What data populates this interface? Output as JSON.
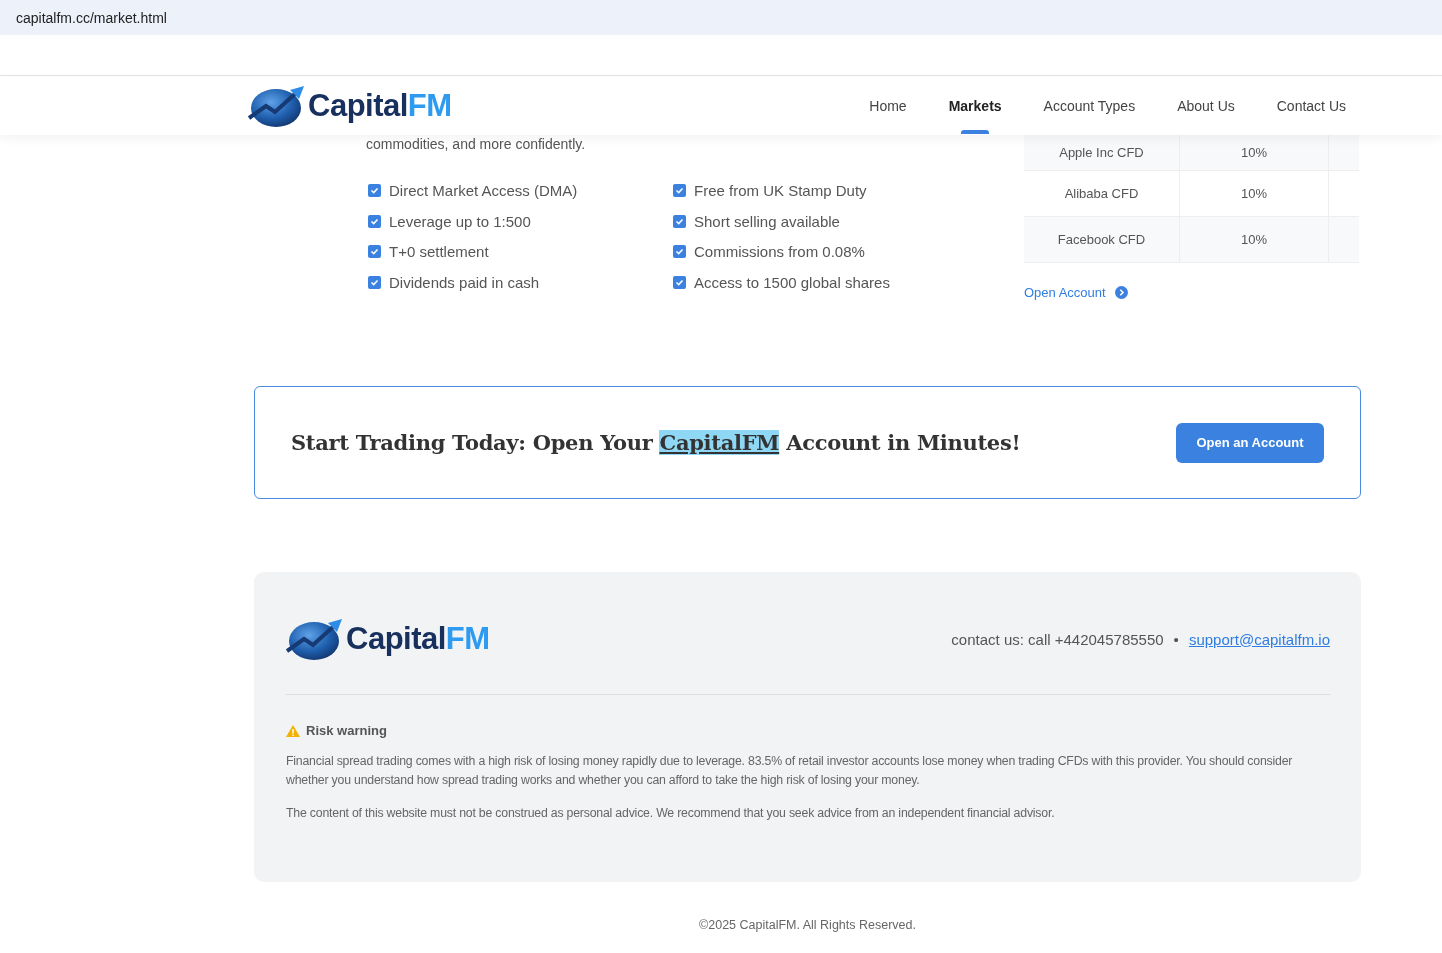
{
  "browser": {
    "url": "capitalfm.cc/market.html"
  },
  "header": {
    "logo": {
      "name": "Capital",
      "accent": "FM"
    },
    "nav": [
      {
        "label": "Home",
        "selected": false
      },
      {
        "label": "Markets",
        "selected": true
      },
      {
        "label": "Account Types",
        "selected": false
      },
      {
        "label": "About Us",
        "selected": false
      },
      {
        "label": "Contact Us",
        "selected": false
      }
    ]
  },
  "intro": "commodities, and more confidently.",
  "features": [
    {
      "label": "Direct Market Access (DMA)",
      "checked": true
    },
    {
      "label": "Leverage up to 1:500",
      "checked": true
    },
    {
      "label": "T+0 settlement",
      "checked": true
    },
    {
      "label": "Dividends paid in cash",
      "checked": true
    },
    {
      "label": "Free from UK Stamp Duty",
      "checked": true
    },
    {
      "label": "Short selling available",
      "checked": true
    },
    {
      "label": "Commissions from 0.08%",
      "checked": true
    },
    {
      "label": "Access to 1500 global shares",
      "checked": true
    }
  ],
  "table": {
    "rows": [
      {
        "name": "Apple Inc CFD",
        "value": "10%"
      },
      {
        "name": "Alibaba CFD",
        "value": "10%"
      },
      {
        "name": "Facebook CFD",
        "value": "10%"
      }
    ]
  },
  "open_account_link": "Open Account",
  "cta": {
    "title_before": "Start Trading Today: Open Your ",
    "title_highlight": "CapitalFM",
    "title_after": " Account in Minutes!",
    "button": "Open an Account"
  },
  "footer": {
    "logo": {
      "name": "Capital",
      "accent": "FM"
    },
    "contact": "contact us: call +442045785550",
    "separator": "•",
    "email": "support@capitalfm.io",
    "risk_title": "Risk warning",
    "paragraphs": [
      "Financial spread trading comes with a high risk of losing money rapidly due to leverage. 83.5% of retail investor accounts lose money when trading CFDs with this provider. You should consider whether you understand how spread trading works and whether you can afford to take the high risk of losing your money.",
      "The content of this website must not be construed as personal advice. We recommend that you seek advice from an independent financial advisor."
    ],
    "copyright": "©2025 CapitalFM. All Rights Reserved."
  }
}
